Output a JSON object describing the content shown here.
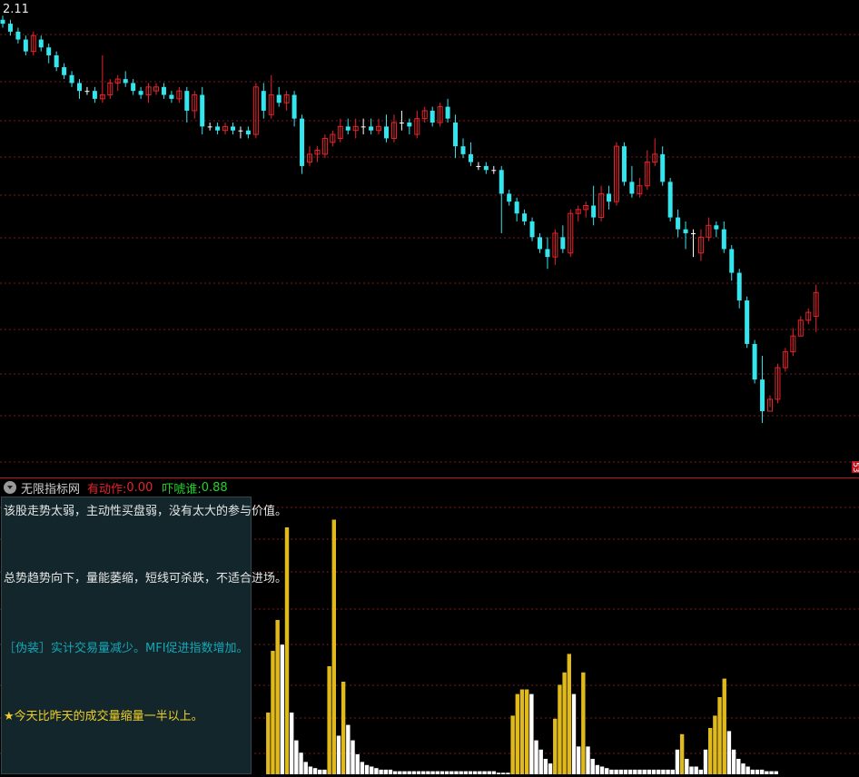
{
  "price_label": "2.11",
  "right_tag": "53",
  "indicator": {
    "name": "无限指标网",
    "label1": "有动作: ",
    "value1": "0.00",
    "label2": "吓唬谁: ",
    "value2": "0.88"
  },
  "notes": {
    "line1": "该股走势太弱，主动性买盘弱，没有太大的参与价值。",
    "line2": "总势趋势向下，量能萎缩，短线可杀跌，不适合进场。",
    "line3": "［伪装］实计交易量减少。MFI促进指数增加。",
    "line4": "★今天比昨天的成交量缩量一半以上。"
  },
  "colors": {
    "up": "#e8232a",
    "down": "#35e5ee",
    "doji": "#ffffff",
    "vol_up": "#e0b91c",
    "vol_down": "#ffffff",
    "grid": "#7a1a1a"
  },
  "chart_data": [
    {
      "type": "candlestick",
      "series": [
        {
          "name": "",
          "ohlc": [
            [
              2.11,
              2.12,
              2.09,
              2.1
            ],
            [
              2.1,
              2.11,
              2.07,
              2.08
            ],
            [
              2.08,
              2.09,
              2.05,
              2.06
            ],
            [
              2.06,
              2.07,
              2.02,
              2.03
            ],
            [
              2.03,
              2.08,
              2.02,
              2.07
            ],
            [
              2.06,
              2.07,
              2.03,
              2.04
            ],
            [
              2.04,
              2.05,
              2.0,
              2.02
            ],
            [
              2.02,
              2.03,
              1.98,
              1.99
            ],
            [
              1.99,
              2.0,
              1.96,
              1.97
            ],
            [
              1.97,
              1.98,
              1.94,
              1.95
            ],
            [
              1.95,
              1.96,
              1.91,
              1.93
            ],
            [
              1.93,
              1.94,
              1.92,
              1.93
            ],
            [
              1.93,
              1.94,
              1.9,
              1.91
            ],
            [
              1.91,
              2.02,
              1.9,
              1.92
            ],
            [
              1.92,
              1.96,
              1.91,
              1.95
            ],
            [
              1.95,
              1.97,
              1.93,
              1.96
            ],
            [
              1.96,
              1.98,
              1.94,
              1.95
            ],
            [
              1.95,
              1.96,
              1.92,
              1.93
            ],
            [
              1.93,
              1.94,
              1.91,
              1.92
            ],
            [
              1.92,
              1.95,
              1.9,
              1.94
            ],
            [
              1.93,
              1.95,
              1.92,
              1.94
            ],
            [
              1.94,
              1.95,
              1.91,
              1.92
            ],
            [
              1.92,
              1.93,
              1.9,
              1.91
            ],
            [
              1.91,
              1.94,
              1.9,
              1.93
            ],
            [
              1.93,
              1.94,
              1.85,
              1.88
            ],
            [
              1.88,
              1.93,
              1.86,
              1.92
            ],
            [
              1.92,
              1.94,
              1.82,
              1.84
            ],
            [
              1.84,
              1.85,
              1.83,
              1.84
            ],
            [
              1.84,
              1.85,
              1.82,
              1.83
            ],
            [
              1.83,
              1.85,
              1.82,
              1.84
            ],
            [
              1.84,
              1.85,
              1.82,
              1.83
            ],
            [
              1.83,
              1.84,
              1.81,
              1.83
            ],
            [
              1.83,
              1.84,
              1.81,
              1.82
            ],
            [
              1.82,
              1.95,
              1.81,
              1.94
            ],
            [
              1.93,
              1.95,
              1.86,
              1.88
            ],
            [
              1.87,
              1.97,
              1.86,
              1.92
            ],
            [
              1.92,
              1.94,
              1.89,
              1.9
            ],
            [
              1.9,
              1.93,
              1.88,
              1.92
            ],
            [
              1.92,
              1.93,
              1.84,
              1.86
            ],
            [
              1.86,
              1.87,
              1.72,
              1.74
            ],
            [
              1.75,
              1.79,
              1.74,
              1.77
            ],
            [
              1.77,
              1.79,
              1.75,
              1.78
            ],
            [
              1.77,
              1.82,
              1.76,
              1.81
            ],
            [
              1.8,
              1.83,
              1.79,
              1.82
            ],
            [
              1.81,
              1.86,
              1.8,
              1.84
            ],
            [
              1.84,
              1.86,
              1.82,
              1.83
            ],
            [
              1.83,
              1.86,
              1.81,
              1.84
            ],
            [
              1.84,
              1.86,
              1.82,
              1.84
            ],
            [
              1.84,
              1.86,
              1.82,
              1.83
            ],
            [
              1.83,
              1.86,
              1.82,
              1.84
            ],
            [
              1.84,
              1.87,
              1.8,
              1.81
            ],
            [
              1.81,
              1.87,
              1.8,
              1.85
            ],
            [
              1.85,
              1.88,
              1.83,
              1.85
            ],
            [
              1.85,
              1.86,
              1.82,
              1.84
            ],
            [
              1.82,
              1.88,
              1.81,
              1.86
            ],
            [
              1.86,
              1.89,
              1.85,
              1.88
            ],
            [
              1.88,
              1.89,
              1.84,
              1.85
            ],
            [
              1.85,
              1.9,
              1.84,
              1.89
            ],
            [
              1.89,
              1.91,
              1.85,
              1.86
            ],
            [
              1.85,
              1.87,
              1.76,
              1.79
            ],
            [
              1.79,
              1.81,
              1.76,
              1.77
            ],
            [
              1.77,
              1.8,
              1.74,
              1.75
            ],
            [
              1.74,
              1.75,
              1.73,
              1.74
            ],
            [
              1.74,
              1.75,
              1.72,
              1.73
            ],
            [
              1.73,
              1.74,
              1.72,
              1.73
            ],
            [
              1.73,
              1.74,
              1.57,
              1.67
            ],
            [
              1.67,
              1.68,
              1.64,
              1.65
            ],
            [
              1.65,
              1.66,
              1.6,
              1.62
            ],
            [
              1.62,
              1.63,
              1.59,
              1.6
            ],
            [
              1.6,
              1.61,
              1.55,
              1.56
            ],
            [
              1.56,
              1.57,
              1.52,
              1.53
            ],
            [
              1.53,
              1.56,
              1.48,
              1.51
            ],
            [
              1.51,
              1.58,
              1.49,
              1.57
            ],
            [
              1.56,
              1.59,
              1.52,
              1.53
            ],
            [
              1.52,
              1.63,
              1.51,
              1.62
            ],
            [
              1.62,
              1.64,
              1.6,
              1.63
            ],
            [
              1.63,
              1.65,
              1.61,
              1.64
            ],
            [
              1.64,
              1.69,
              1.59,
              1.61
            ],
            [
              1.61,
              1.69,
              1.6,
              1.67
            ],
            [
              1.67,
              1.69,
              1.63,
              1.65
            ],
            [
              1.65,
              1.8,
              1.64,
              1.79
            ],
            [
              1.79,
              1.8,
              1.69,
              1.7
            ],
            [
              1.7,
              1.74,
              1.66,
              1.67
            ],
            [
              1.67,
              1.71,
              1.66,
              1.69
            ],
            [
              1.69,
              1.78,
              1.68,
              1.75
            ],
            [
              1.75,
              1.81,
              1.74,
              1.77
            ],
            [
              1.77,
              1.79,
              1.69,
              1.7
            ],
            [
              1.7,
              1.71,
              1.6,
              1.61
            ],
            [
              1.61,
              1.63,
              1.56,
              1.58
            ],
            [
              1.58,
              1.6,
              1.53,
              1.57
            ],
            [
              1.57,
              1.58,
              1.51,
              1.57
            ],
            [
              1.52,
              1.58,
              1.5,
              1.56
            ],
            [
              1.56,
              1.61,
              1.55,
              1.59
            ],
            [
              1.59,
              1.6,
              1.56,
              1.58
            ],
            [
              1.58,
              1.6,
              1.52,
              1.53
            ],
            [
              1.53,
              1.54,
              1.45,
              1.47
            ],
            [
              1.47,
              1.48,
              1.38,
              1.4
            ],
            [
              1.4,
              1.41,
              1.28,
              1.29
            ],
            [
              1.29,
              1.3,
              1.19,
              1.2
            ],
            [
              1.2,
              1.26,
              1.09,
              1.12
            ],
            [
              1.12,
              1.16,
              1.13,
              1.15
            ],
            [
              1.15,
              1.24,
              1.14,
              1.23
            ],
            [
              1.23,
              1.28,
              1.22,
              1.27
            ],
            [
              1.27,
              1.33,
              1.26,
              1.31
            ],
            [
              1.31,
              1.36,
              1.31,
              1.35
            ],
            [
              1.35,
              1.38,
              1.34,
              1.37
            ],
            [
              1.36,
              1.44,
              1.32,
              1.42
            ]
          ]
        }
      ],
      "ylim": [
        0.95,
        2.16
      ]
    },
    {
      "type": "bar",
      "series": [
        {
          "name": "",
          "values": [
            0,
            0,
            0,
            0,
            0,
            0,
            0,
            0,
            0,
            0,
            0,
            0,
            0,
            0,
            0,
            0,
            0,
            0,
            0,
            0,
            0,
            0,
            0,
            0,
            0,
            0,
            0,
            0,
            0,
            0,
            0,
            0,
            0,
            0,
            0,
            0,
            0,
            0,
            0,
            0,
            0,
            0,
            0,
            0,
            0,
            0,
            0,
            0,
            0,
            0,
            0,
            0,
            0,
            0,
            0,
            0,
            40,
            80,
            100,
            84,
            160,
            40,
            22,
            14,
            8,
            5,
            4,
            3,
            3,
            70,
            165,
            25,
            60,
            32,
            22,
            13,
            8,
            6,
            5,
            4,
            3,
            3,
            3,
            2,
            2,
            2,
            2,
            2,
            2,
            2,
            2,
            2,
            2,
            2,
            2,
            2,
            2,
            2,
            2,
            2,
            2,
            2,
            2,
            2,
            2,
            1,
            1,
            1,
            38,
            52,
            55,
            55,
            52,
            22,
            16,
            10,
            7,
            36,
            58,
            66,
            78,
            52,
            18,
            66,
            18,
            10,
            6,
            5,
            4,
            3,
            3,
            3,
            3,
            3,
            3,
            3,
            3,
            3,
            3,
            3,
            3,
            3,
            3,
            16,
            26,
            10,
            5,
            5,
            3,
            16,
            30,
            38,
            50,
            62,
            28,
            16,
            10,
            7,
            5,
            3,
            3,
            3,
            2,
            2,
            2
          ]
        }
      ]
    }
  ]
}
